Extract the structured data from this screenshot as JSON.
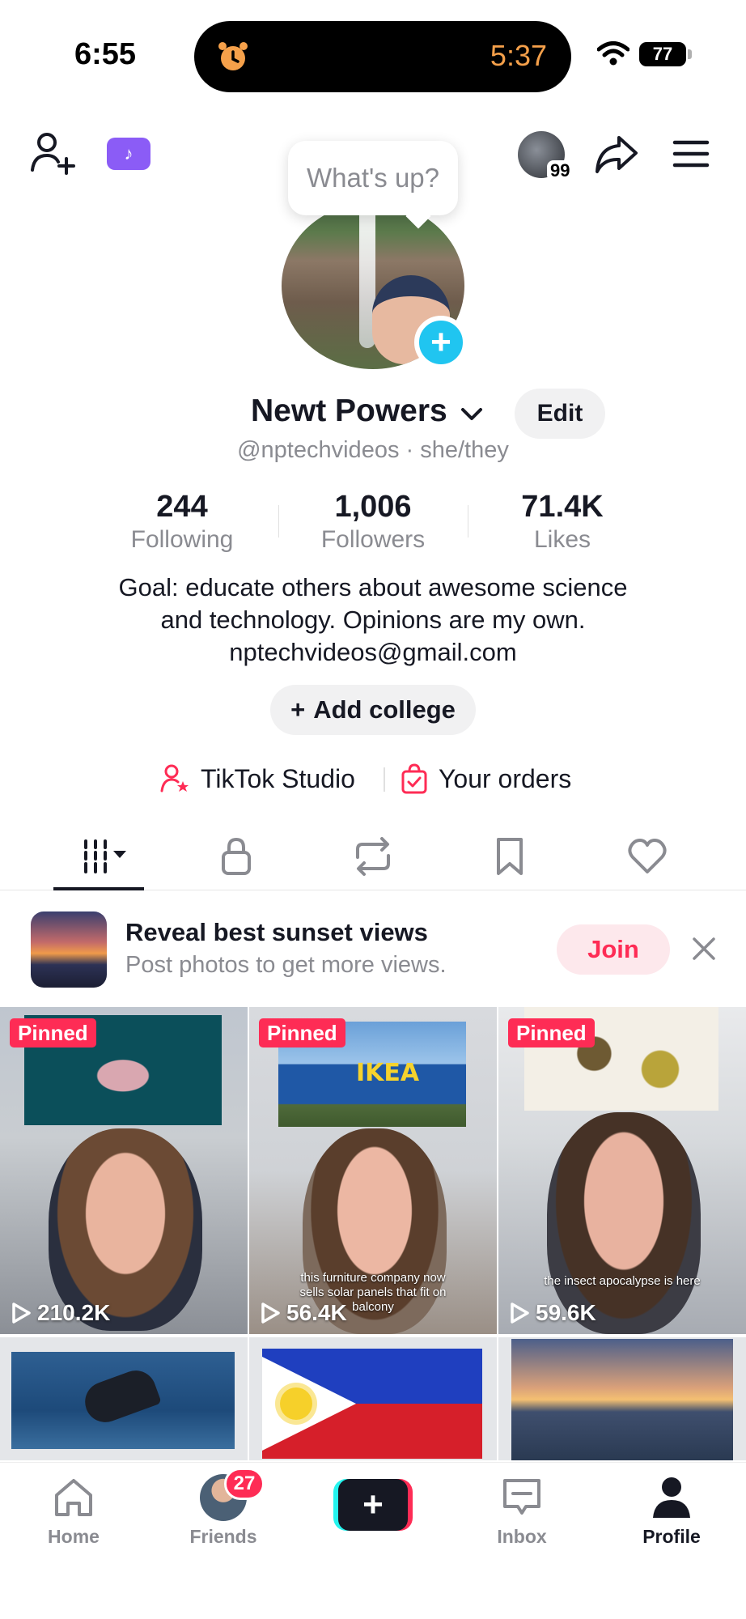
{
  "status_bar": {
    "time": "6:55",
    "timer": "5:37",
    "battery": "77",
    "icons": [
      "alarm-icon",
      "wifi-icon",
      "battery-icon"
    ]
  },
  "top_nav": {
    "studio_badge": "♪",
    "story_count": "99",
    "icons": [
      "add-friend-icon",
      "tiktok-studio-icon",
      "share-icon",
      "menu-icon"
    ]
  },
  "profile": {
    "whats_up": "What's up?",
    "display_name": "Newt Powers",
    "edit_label": "Edit",
    "handle": "@nptechvideos",
    "pronouns_sep": " · ",
    "pronouns": "she/they",
    "stats": [
      {
        "value": "244",
        "label": "Following"
      },
      {
        "value": "1,006",
        "label": "Followers"
      },
      {
        "value": "71.4K",
        "label": "Likes"
      }
    ],
    "bio_lines": [
      "Goal: educate others about awesome science",
      "and technology. Opinions are my own.",
      "nptechvideos@gmail.com"
    ],
    "add_college_plus": "+",
    "add_college_label": "Add college",
    "studio_link": "TikTok Studio",
    "orders_link": "Your orders"
  },
  "tabs": {
    "items": [
      "videos-tab",
      "private-tab",
      "reposts-tab",
      "favorites-tab",
      "liked-tab"
    ],
    "active": "videos-tab"
  },
  "banner": {
    "title": "Reveal best sunset views",
    "subtitle": "Post photos to get more views.",
    "join_label": "Join"
  },
  "videos": [
    {
      "pinned": "Pinned",
      "views": "210.2K",
      "caption": ""
    },
    {
      "pinned": "Pinned",
      "views": "56.4K",
      "caption_line1": "this furniture company now",
      "caption_line2": "sells solar panels that fit on",
      "caption_line3": "balcony"
    },
    {
      "pinned": "Pinned",
      "views": "59.6K",
      "caption_line1": "the insect apocalypse is here"
    },
    {
      "pinned": "",
      "views": ""
    },
    {
      "pinned": "",
      "views": ""
    },
    {
      "pinned": "",
      "views": ""
    }
  ],
  "video_inset_text": {
    "ikea": "IKEA"
  },
  "bottom_nav": {
    "home": "Home",
    "friends": "Friends",
    "friends_badge": "27",
    "create": "+",
    "inbox": "Inbox",
    "profile": "Profile"
  },
  "colors": {
    "accent": "#fe2c55",
    "cyan": "#25f4ee",
    "text_primary": "#161823",
    "text_secondary": "#8a8b91"
  }
}
